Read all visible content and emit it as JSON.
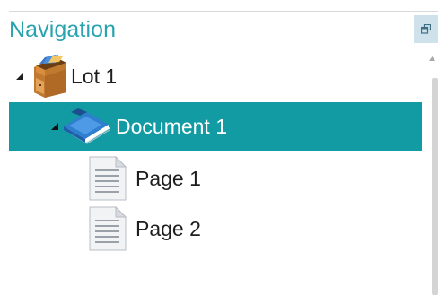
{
  "panel": {
    "title": "Navigation"
  },
  "icons": {
    "restore": "restore-window-icon",
    "scroll_up": "scroll-up-arrow-icon",
    "lot": "file-cabinet-icon",
    "document": "book-icon",
    "page": "page-icon",
    "expander": "expanded-triangle-icon"
  },
  "colors": {
    "title": "#2aa3b0",
    "selection": "#129ba3",
    "restore_button": "#cfe1eb"
  },
  "tree": {
    "lot": {
      "label": "Lot 1",
      "expanded": true
    },
    "document": {
      "label": "Document 1",
      "expanded": true,
      "selected": true
    },
    "pages": [
      {
        "label": "Page 1"
      },
      {
        "label": "Page 2"
      }
    ]
  }
}
